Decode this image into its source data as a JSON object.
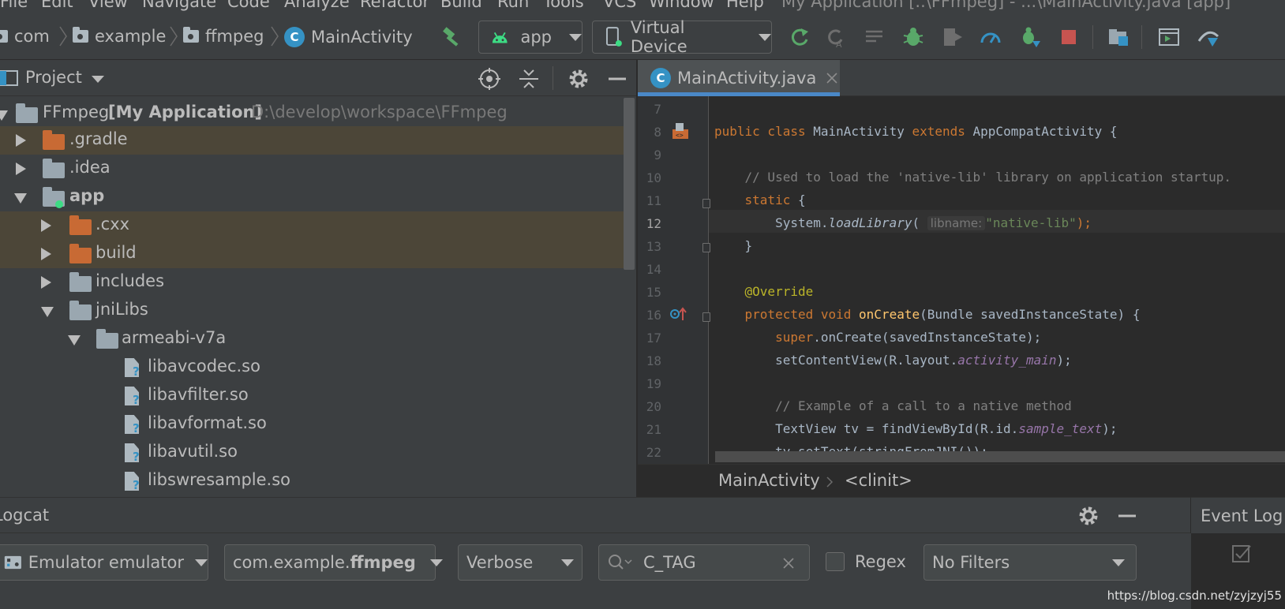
{
  "menu": {
    "items": [
      "File",
      "Edit",
      "View",
      "Navigate",
      "Code",
      "Analyze",
      "Refactor",
      "Build",
      "Run",
      "Tools",
      "VCS",
      "Window",
      "Help"
    ],
    "window_title": "My Application [..\\FFmpeg] - ...\\MainActivity.java [app]"
  },
  "navbar": {
    "crumbs": [
      "com",
      "example",
      "ffmpeg",
      "MainActivity"
    ],
    "run_config": "app",
    "device": "Virtual Device"
  },
  "project_panel": {
    "title": "Project",
    "tree": [
      {
        "label": "FFmpeg",
        "bold_suffix": "[My Application]",
        "path": "D:\\develop\\workspace\\FFmpeg"
      },
      {
        "label": ".gradle"
      },
      {
        "label": ".idea"
      },
      {
        "label": "app"
      },
      {
        "label": ".cxx"
      },
      {
        "label": "build"
      },
      {
        "label": "includes"
      },
      {
        "label": "jniLibs"
      },
      {
        "label": "armeabi-v7a"
      },
      {
        "label": "libavcodec.so"
      },
      {
        "label": "libavfilter.so"
      },
      {
        "label": "libavformat.so"
      },
      {
        "label": "libavutil.so"
      },
      {
        "label": "libswresample.so"
      }
    ]
  },
  "editor": {
    "tab_label": "MainActivity.java",
    "tab_badge": "C",
    "line_numbers": [
      "7",
      "8",
      "9",
      "10",
      "11",
      "12",
      "13",
      "14",
      "15",
      "16",
      "17",
      "18",
      "19",
      "20",
      "21",
      "22"
    ],
    "current_line": "12",
    "code": {
      "l8_kw": "public class ",
      "l8_name": "MainActivity ",
      "l8_kw2": "extends ",
      "l8_rest": "AppCompatActivity {",
      "l10": "    // Used to load the 'native-lib' library on application startup.",
      "l11_kw": "    static ",
      "l11_rest": "{",
      "l12_a": "        System.",
      "l12_b": "loadLibrary",
      "l12_c": "(",
      "l12_hint": "libname:",
      "l12_str": "\"native-lib\"",
      "l12_d": ");",
      "l13": "    }",
      "l15": "    @Override",
      "l16_kw": "    protected void ",
      "l16_fn": "onCreate",
      "l16_rest": "(Bundle savedInstanceState) {",
      "l17_kw": "        super",
      "l17_rest": ".onCreate(savedInstanceState);",
      "l18_a": "        setContentView(R.layout.",
      "l18_fld": "activity_main",
      "l18_b": ");",
      "l20": "        // Example of a call to a native method",
      "l21_a": "        TextView tv = findViewById(R.id.",
      "l21_fld": "sample_text",
      "l21_b": ");",
      "l22": "        tv.setText(stringFromJNI());"
    },
    "breadcrumb": [
      "MainActivity",
      "<clinit>"
    ]
  },
  "logcat": {
    "title": "Logcat",
    "device": "Emulator emulator",
    "package_prefix": "com.example.",
    "package_bold": "ffmpeg",
    "level": "Verbose",
    "search_value": "C_TAG",
    "regex_label": "Regex",
    "filter": "No Filters"
  },
  "event_log": {
    "title": "Event Log"
  },
  "watermark": "https://blog.csdn.net/zyjzyj55",
  "colors": {
    "accent": "#4a88c7",
    "android_green": "#3ddc84",
    "run_green": "#59a869",
    "stop_red": "#c75450"
  }
}
